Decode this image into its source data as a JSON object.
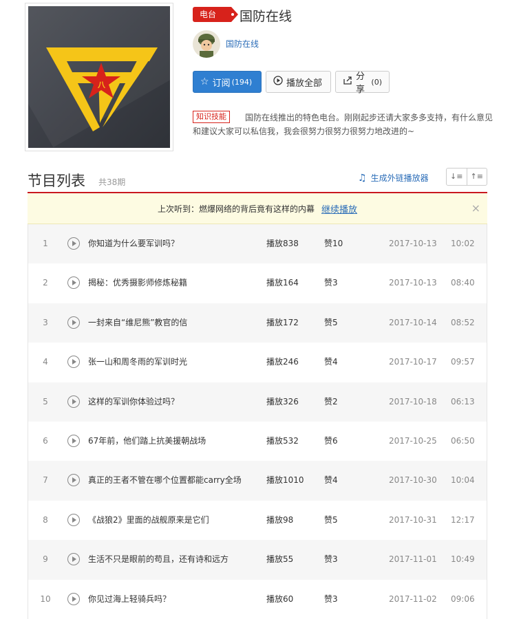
{
  "channel": {
    "badge": "电台",
    "title": "国防在线",
    "author": "国防在线",
    "cover_icon": "army-logo-icon"
  },
  "actions": {
    "subscribe_label": "订阅",
    "subscribe_count": "(194)",
    "play_all_label": "播放全部",
    "share_label": "分享",
    "share_count": "(0)"
  },
  "description": {
    "tag": "知识技能",
    "text": "国防在线推出的特色电台。刚刚起步还请大家多多支持，有什么意见和建议大家可以私信我，我会很努力很努力很努力地改进的~"
  },
  "list": {
    "title": "节目列表",
    "count": "共38期",
    "player_link": "生成外链播放器",
    "sort_desc": "↓≡",
    "sort_asc": "↑≡"
  },
  "notice": {
    "text": "上次听到：燃爆网络的背后竟有这样的内幕",
    "continue": "继续播放",
    "close": "×"
  },
  "episodes": [
    {
      "num": "1",
      "title": "你知道为什么要军训吗？",
      "plays": "播放838",
      "likes": "赞10",
      "date": "2017-10-13",
      "time": "10:02"
    },
    {
      "num": "2",
      "title": "揭秘：优秀摄影师修炼秘籍",
      "plays": "播放164",
      "likes": "赞3",
      "date": "2017-10-13",
      "time": "08:40"
    },
    {
      "num": "3",
      "title": "一封来自“维尼熊”教官的信",
      "plays": "播放172",
      "likes": "赞5",
      "date": "2017-10-14",
      "time": "08:52"
    },
    {
      "num": "4",
      "title": "张一山和周冬雨的军训时光",
      "plays": "播放246",
      "likes": "赞4",
      "date": "2017-10-17",
      "time": "09:57"
    },
    {
      "num": "5",
      "title": "这样的军训你体验过吗？",
      "plays": "播放326",
      "likes": "赞2",
      "date": "2017-10-18",
      "time": "06:13"
    },
    {
      "num": "6",
      "title": "67年前，他们踏上抗美援朝战场",
      "plays": "播放532",
      "likes": "赞6",
      "date": "2017-10-25",
      "time": "06:50"
    },
    {
      "num": "7",
      "title": "真正的王者不管在哪个位置都能carry全场",
      "plays": "播放1010",
      "likes": "赞4",
      "date": "2017-10-30",
      "time": "10:04"
    },
    {
      "num": "8",
      "title": "《战狼2》里面的战舰原来是它们",
      "plays": "播放98",
      "likes": "赞5",
      "date": "2017-10-31",
      "time": "12:17"
    },
    {
      "num": "9",
      "title": "生活不只是眼前的苟且，还有诗和远方",
      "plays": "播放55",
      "likes": "赞3",
      "date": "2017-11-01",
      "time": "10:49"
    },
    {
      "num": "10",
      "title": "你见过海上轻骑兵吗？",
      "plays": "播放60",
      "likes": "赞3",
      "date": "2017-11-02",
      "time": "09:06"
    }
  ],
  "colors": {
    "accent": "#d7221b",
    "link": "#2b6db8",
    "subscribe_bg": "#2f7fd1",
    "logo_yellow": "#f5c518",
    "notice_bg": "#fdfbe2"
  }
}
